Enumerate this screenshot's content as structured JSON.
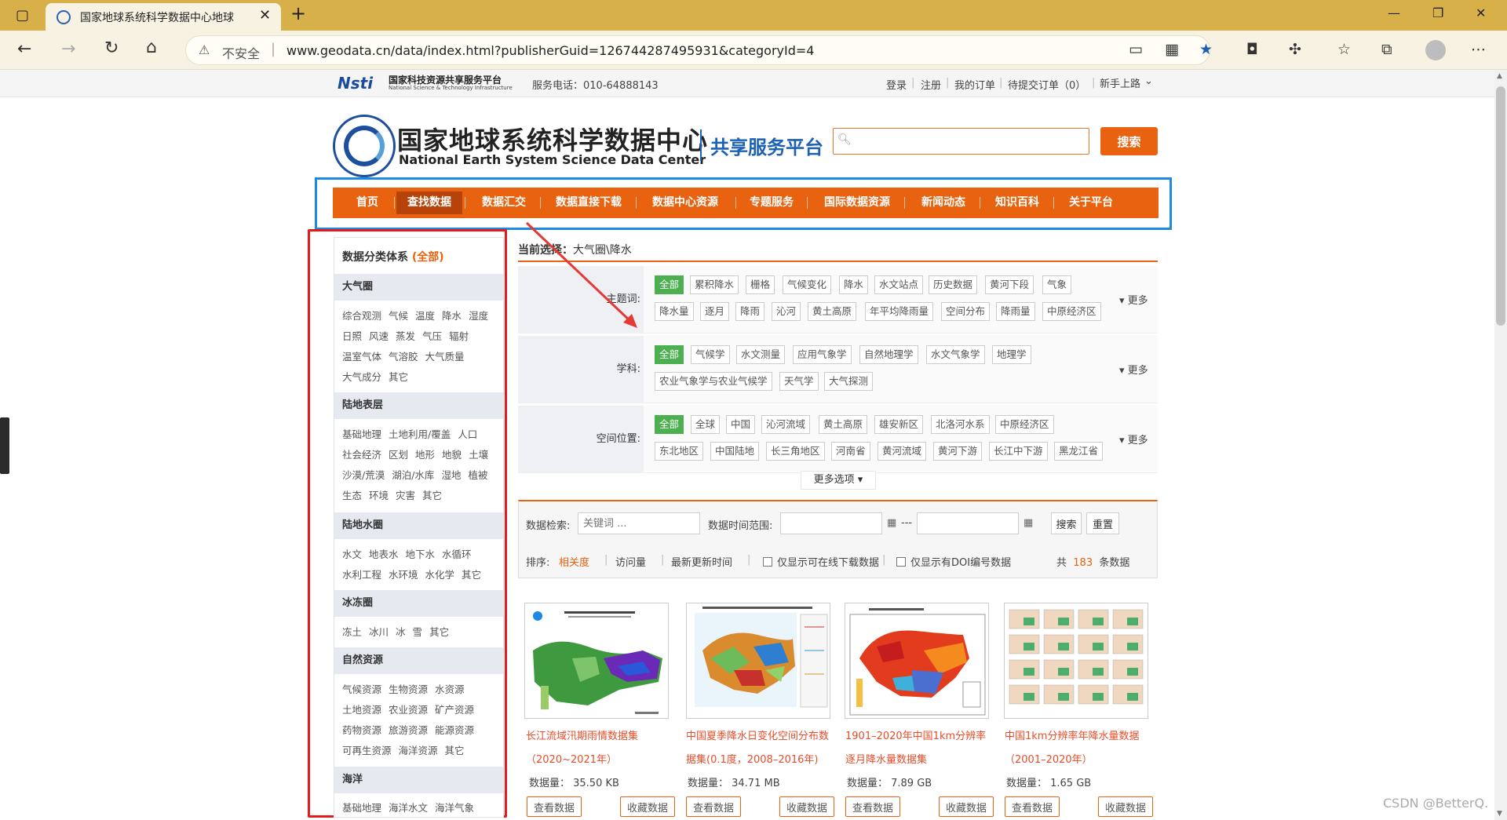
{
  "browser": {
    "tab_title": "国家地球系统科学数据中心地球",
    "address_warning": "不安全",
    "url": "www.geodata.cn/data/index.html?publisherGuid=126744287495931&categoryId=4"
  },
  "top_strip": {
    "nsti_logo": "Nsti",
    "platform_name": "国家科技资源共享服务平台",
    "platform_name_en": "National Science & Technology Infrastructure",
    "hotline": "服务电话：010-64888143",
    "links": [
      "登录",
      "注册",
      "我的订单",
      "待提交订单（0）",
      "新手上路"
    ]
  },
  "header": {
    "site_name_cn": "国家地球系统科学数据中心",
    "site_name_en": "National Earth System Science Data Center",
    "platform": "共享服务平台",
    "search_button": "搜索"
  },
  "nav": [
    "首页",
    "查找数据",
    "数据汇交",
    "数据直接下载",
    "数据中心资源",
    "专题服务",
    "国际数据资源",
    "新闻动态",
    "知识百科",
    "关于平台"
  ],
  "sidebar": {
    "title": "数据分类体系",
    "all_label": "(全部)",
    "categories": [
      {
        "name": "大气圈",
        "lines": [
          [
            "综合观测",
            "气候",
            "温度",
            "降水",
            "湿度"
          ],
          [
            "日照",
            "风速",
            "蒸发",
            "气压",
            "辐射"
          ],
          [
            "温室气体",
            "气溶胶",
            "大气质量"
          ],
          [
            "大气成分",
            "其它"
          ]
        ]
      },
      {
        "name": "陆地表层",
        "lines": [
          [
            "基础地理",
            "土地利用/覆盖",
            "人口"
          ],
          [
            "社会经济",
            "区划",
            "地形",
            "地貌",
            "土壤"
          ],
          [
            "沙漠/荒漠",
            "湖泊/水库",
            "湿地",
            "植被"
          ],
          [
            "生态",
            "环境",
            "灾害",
            "其它"
          ]
        ]
      },
      {
        "name": "陆地水圈",
        "lines": [
          [
            "水文",
            "地表水",
            "地下水",
            "水循环"
          ],
          [
            "水利工程",
            "水环境",
            "水化学",
            "其它"
          ]
        ]
      },
      {
        "name": "冰冻圈",
        "lines": [
          [
            "冻土",
            "冰川",
            "冰",
            "雪",
            "其它"
          ]
        ]
      },
      {
        "name": "自然资源",
        "lines": [
          [
            "气候资源",
            "生物资源",
            "水资源"
          ],
          [
            "土地资源",
            "农业资源",
            "矿产资源"
          ],
          [
            "药物资源",
            "旅游资源",
            "能源资源"
          ],
          [
            "可再生资源",
            "海洋资源",
            "其它"
          ]
        ]
      },
      {
        "name": "海洋",
        "lines": [
          [
            "基础地理",
            "海洋水文",
            "海洋气象"
          ]
        ]
      }
    ]
  },
  "filters": {
    "current_label": "当前选择：",
    "current_value": "大气圈\\降水",
    "theme_label": "主题词:",
    "theme_row1": [
      "全部",
      "累积降水",
      "栅格",
      "气候变化",
      "降水",
      "水文站点",
      "历史数据",
      "黄河下段",
      "气象"
    ],
    "theme_row2": [
      "降水量",
      "逐月",
      "降雨",
      "沁河",
      "黄土高原",
      "年平均降雨量",
      "空间分布",
      "降雨量",
      "中原经济区"
    ],
    "subject_label": "学科:",
    "subject_row1": [
      "全部",
      "气候学",
      "水文测量",
      "应用气象学",
      "自然地理学",
      "水文气象学",
      "地理学"
    ],
    "subject_row2": [
      "农业气象学与农业气候学",
      "天气学",
      "大气探测"
    ],
    "space_label": "空间位置:",
    "space_row1": [
      "全部",
      "全球",
      "中国",
      "沁河流域",
      "黄土高原",
      "雄安新区",
      "北洛河水系",
      "中原经济区"
    ],
    "space_row2": [
      "东北地区",
      "中国陆地",
      "长三角地区",
      "河南省",
      "黄河流域",
      "黄河下游",
      "长江中下游",
      "黑龙江省"
    ],
    "more": "更多",
    "more_options": "更多选项"
  },
  "data_search": {
    "label": "数据检索:",
    "keyword_placeholder": "关键词 ...",
    "time_label": "数据时间范围:",
    "dash": "---",
    "search_btn": "搜索",
    "reset_btn": "重置",
    "sort_label": "排序:",
    "sort_relevance": "相关度",
    "sort_visits": "访问量",
    "sort_latest": "最新更新时间",
    "only_online": "仅显示可在线下载数据",
    "only_doi": "仅显示有DOI编号数据",
    "total_prefix": "共",
    "total_count": "183",
    "total_suffix": "条数据"
  },
  "cards": [
    {
      "title": "长江流域汛期雨情数据集（2020~2021年）",
      "size": "数据量： 35.50 KB"
    },
    {
      "title": "中国夏季降水日变化空间分布数据集(0.1度，2008–2016年)",
      "size": "数据量： 34.71 MB"
    },
    {
      "title": "1901–2020年中国1km分辨率逐月降水量数据集",
      "size": "数据量： 7.89 GB"
    },
    {
      "title": "中国1km分辨率年降水量数据（2001–2020年）",
      "size": "数据量： 1.65 GB"
    }
  ],
  "card_buttons": {
    "view": "查看数据",
    "collect": "收藏数据"
  },
  "watermark": "CSDN @BetterQ."
}
